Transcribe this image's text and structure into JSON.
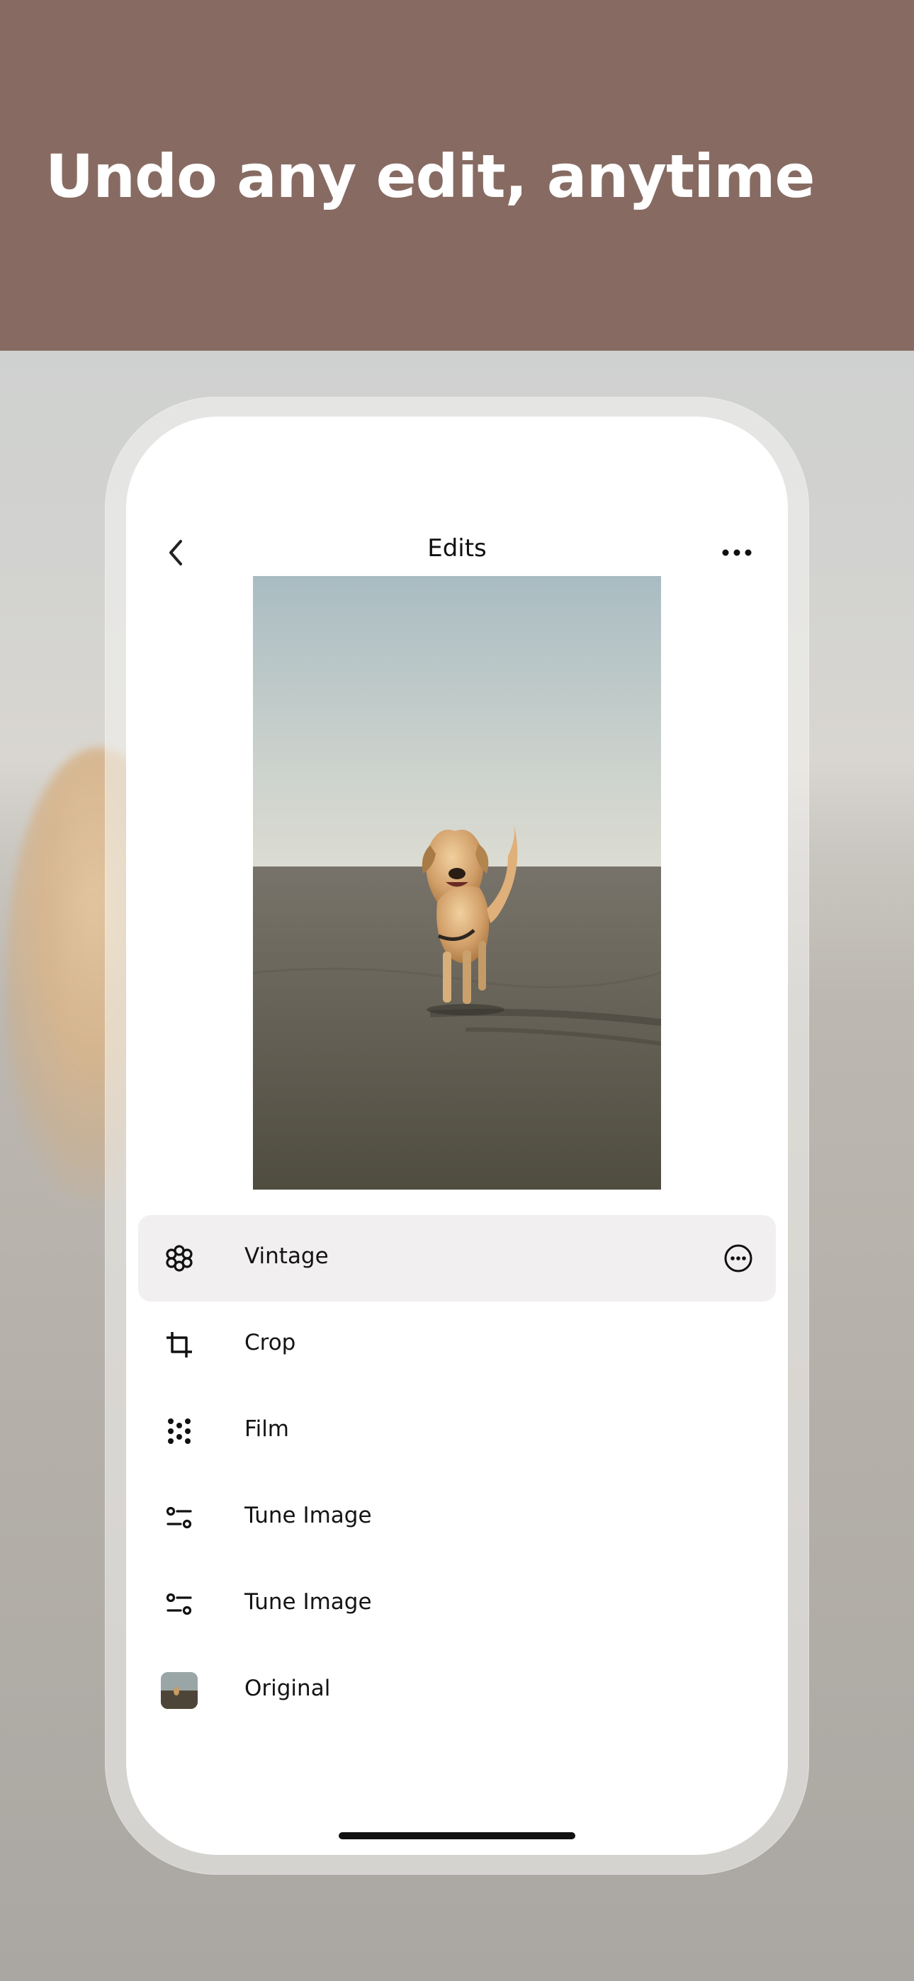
{
  "banner": {
    "headline": "Undo any edit, anytime",
    "background_color": "#876b62"
  },
  "app": {
    "nav": {
      "title": "Edits",
      "back_icon": "chevron-left-icon",
      "more_icon": "ellipsis-horizontal-icon"
    },
    "photo": {
      "subject": "dog-on-beach-photo"
    },
    "edits": [
      {
        "label": "Vintage",
        "icon": "flower-icon",
        "active": true,
        "more_icon": "more-circle-icon"
      },
      {
        "label": "Crop",
        "icon": "crop-icon",
        "active": false
      },
      {
        "label": "Film",
        "icon": "grain-dots-icon",
        "active": false
      },
      {
        "label": "Tune Image",
        "icon": "sliders-icon",
        "active": false
      },
      {
        "label": "Tune Image",
        "icon": "sliders-icon",
        "active": false
      },
      {
        "label": "Original",
        "icon": "original-thumbnail",
        "active": false
      }
    ]
  },
  "colors": {
    "accent_active_row": "#f1eff0",
    "text_primary": "#141414"
  }
}
